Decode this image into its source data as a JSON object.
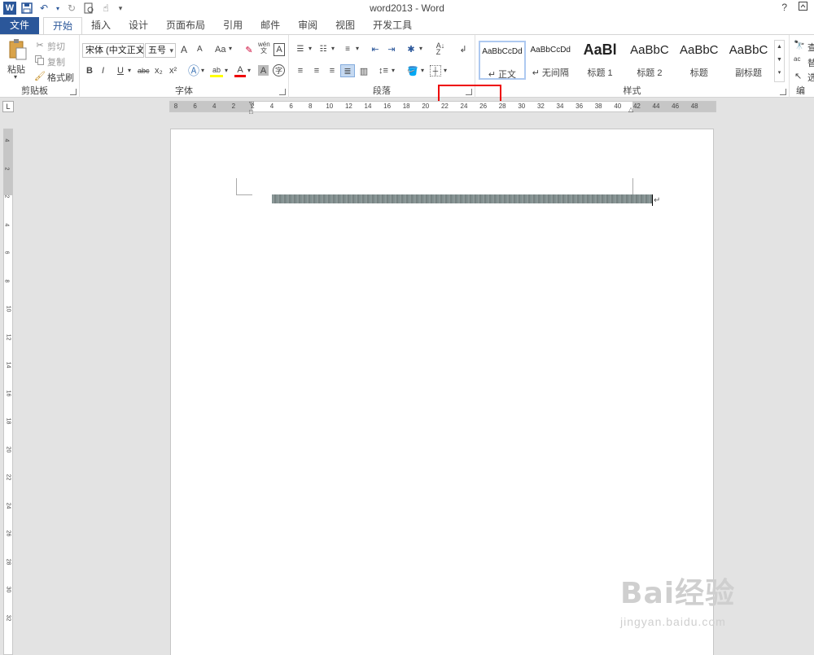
{
  "window": {
    "title": "word2013 - Word",
    "help": "?",
    "restore_icon": "ribbon-display-icon"
  },
  "qat": {
    "icons": [
      "word-logo",
      "save-icon",
      "undo-icon",
      "redo-icon",
      "print-preview-icon",
      "touch-mode-icon",
      "customize-icon"
    ]
  },
  "tabs": [
    "文件",
    "开始",
    "插入",
    "设计",
    "页面布局",
    "引用",
    "邮件",
    "审阅",
    "视图",
    "开发工具"
  ],
  "active_tab": "开始",
  "ribbon": {
    "clipboard": {
      "label": "剪贴板",
      "paste": "粘贴",
      "cut": "剪切",
      "copy": "复制",
      "format_painter": "格式刷"
    },
    "font": {
      "label": "字体",
      "font_name": "宋体 (中文正文",
      "font_size": "五号",
      "grow": "A",
      "shrink": "A",
      "case": "Aa",
      "bold": "B",
      "italic": "I",
      "underline": "U",
      "strike": "abc",
      "subscript": "x₂",
      "superscript": "x²",
      "phonetic": "wén 文",
      "font_color": "A",
      "char_shade": "A",
      "enclose": "字"
    },
    "paragraph": {
      "label": "段落"
    },
    "styles": {
      "label": "样式",
      "items": [
        {
          "preview": "AaBbCcDd",
          "name": "↵ 正文"
        },
        {
          "preview": "AaBbCcDd",
          "name": "↵ 无间隔"
        },
        {
          "preview": "AaBl",
          "name": "标题 1"
        },
        {
          "preview": "AaBbC",
          "name": "标题 2"
        },
        {
          "preview": "AaBbC",
          "name": "标题"
        },
        {
          "preview": "AaBbC",
          "name": "副标题"
        }
      ]
    },
    "editing": {
      "find": "查",
      "replace": "替",
      "select": "选",
      "label": "编"
    }
  },
  "ruler": {
    "corner": "L",
    "h_numbers": [
      "8",
      "6",
      "4",
      "2",
      "2",
      "4",
      "6",
      "8",
      "10",
      "12",
      "14",
      "16",
      "18",
      "20",
      "22",
      "24",
      "26",
      "28",
      "30",
      "32",
      "34",
      "36",
      "38",
      "40",
      "42",
      "44",
      "46",
      "48"
    ],
    "v_numbers": [
      "4",
      "2",
      "2",
      "4",
      "6",
      "8",
      "10",
      "12",
      "14",
      "16",
      "18",
      "20",
      "22",
      "24",
      "26",
      "28",
      "30",
      "32"
    ]
  },
  "watermark": {
    "brand": "Bai经验",
    "url": "jingyan.baidu.com"
  }
}
